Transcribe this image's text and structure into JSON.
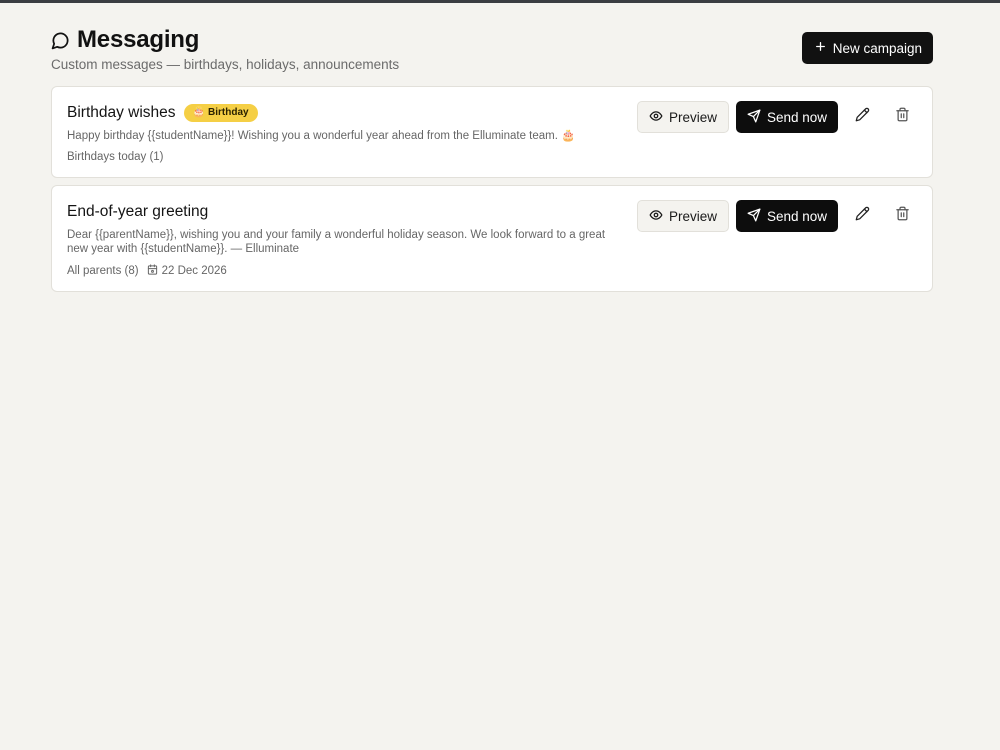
{
  "header": {
    "title": "Messaging",
    "subtitle": "Custom messages — birthdays, holidays, announcements",
    "new_campaign_label": "New campaign",
    "title_icon": "message-circle-icon"
  },
  "campaigns": [
    {
      "title": "Birthday wishes",
      "badge": "Birthday",
      "badge_icon": "🎂",
      "message": "Happy birthday {{studentName}}! Wishing you a wonderful year ahead from the Elluminate team. 🎂",
      "audience": "Birthdays today (1)",
      "preview_label": "Preview",
      "send_label": "Send now"
    },
    {
      "title": "End-of-year greeting",
      "message": "Dear {{parentName}}, wishing you and your family a wonderful holiday season. We look forward to a great new year with {{studentName}}. — Elluminate",
      "audience": "All parents (8)",
      "date": "22 Dec 2026",
      "preview_label": "Preview",
      "send_label": "Send now"
    }
  ],
  "colors": {
    "background": "#f4f3ef",
    "primary": "#111111",
    "badge": "#f5cf45",
    "card": "#ffffff"
  }
}
